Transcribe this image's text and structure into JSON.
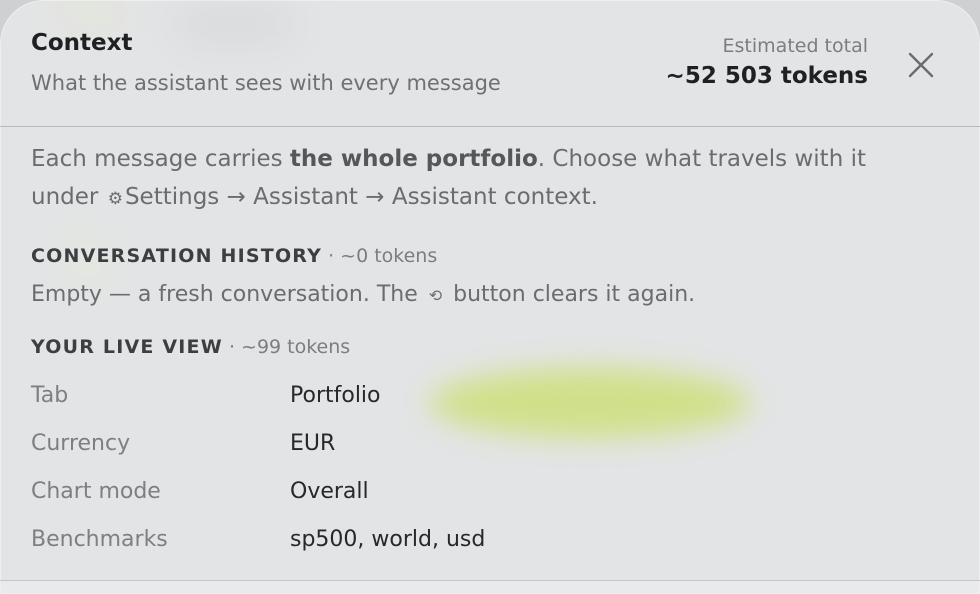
{
  "header": {
    "title": "Context",
    "subtitle": "What the assistant sees with every message",
    "total_label": "Estimated total",
    "total_value": "~52 503 tokens",
    "close_icon": "close-icon"
  },
  "intro": {
    "part1": "Each message carries ",
    "bold": "the whole portfolio",
    "part2": ". Choose what travels with it under",
    "gear_icon": "⚙",
    "path": "Settings → Assistant → Assistant context."
  },
  "history": {
    "title": "CONVERSATION HISTORY",
    "meta": " · ~0 tokens",
    "text_before": "Empty — a fresh conversation. The",
    "reset_icon": "⟲",
    "text_after": "button clears it again."
  },
  "live_view": {
    "title": "YOUR LIVE VIEW",
    "meta": " · ~99 tokens",
    "rows": [
      {
        "key": "Tab",
        "value": "Portfolio"
      },
      {
        "key": "Currency",
        "value": "EUR"
      },
      {
        "key": "Chart mode",
        "value": "Overall"
      },
      {
        "key": "Benchmarks",
        "value": "sp500, world, usd"
      }
    ]
  }
}
